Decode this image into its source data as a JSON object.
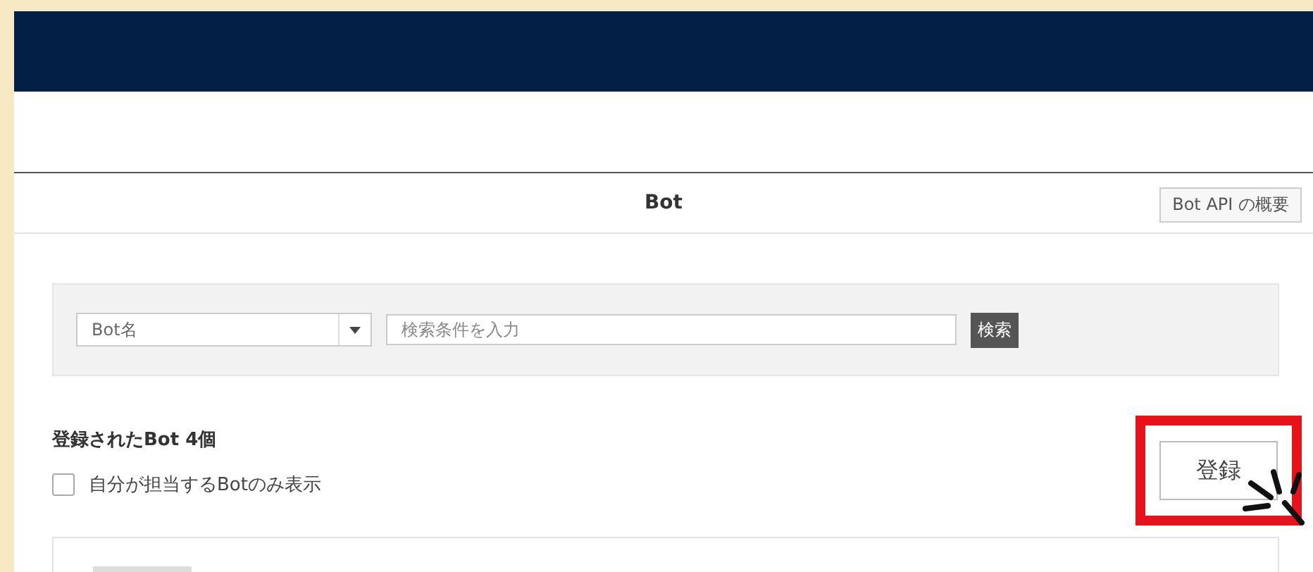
{
  "header": {
    "title": "Bot",
    "api_button": "Bot API の概要"
  },
  "search": {
    "field_select": "Bot名",
    "placeholder": "検索条件を入力",
    "button": "検索"
  },
  "list": {
    "heading": "登録されたBot 4個",
    "filter": {
      "label": "自分が担当するBotのみ表示",
      "checked": false
    },
    "register_button": "登録",
    "register_highlighted": true
  }
}
